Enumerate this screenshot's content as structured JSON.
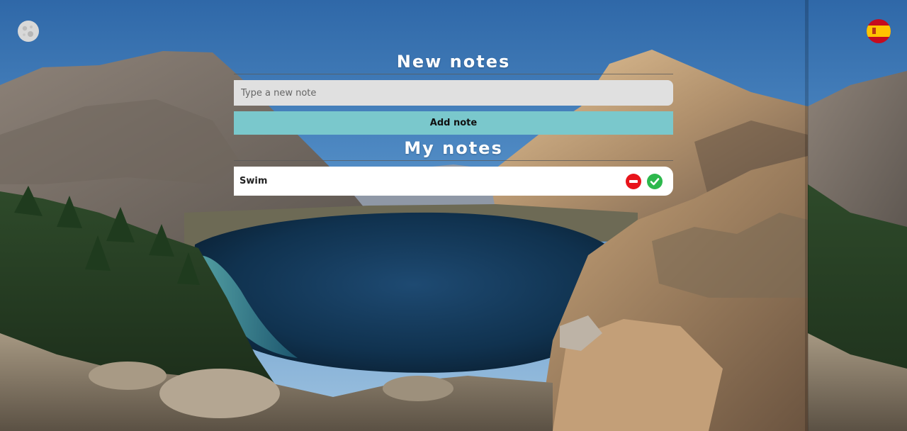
{
  "header": {
    "theme_toggle_icon": "moon-icon",
    "language_flag_icon": "spain-flag-icon"
  },
  "new_notes": {
    "title": "New notes",
    "input_placeholder": "Type a new note",
    "input_value": "",
    "add_button_label": "Add note",
    "add_button_color": "#7ac8cc"
  },
  "my_notes": {
    "title": "My notes",
    "items": [
      {
        "text": "Swim",
        "delete_icon": "minus-circle-icon",
        "delete_color": "#e8141b",
        "complete_icon": "check-circle-icon",
        "complete_color": "#2db84d"
      }
    ]
  },
  "colors": {
    "title_text": "#ffffff",
    "input_background": "#e0e0e0",
    "note_background": "#ffffff"
  }
}
